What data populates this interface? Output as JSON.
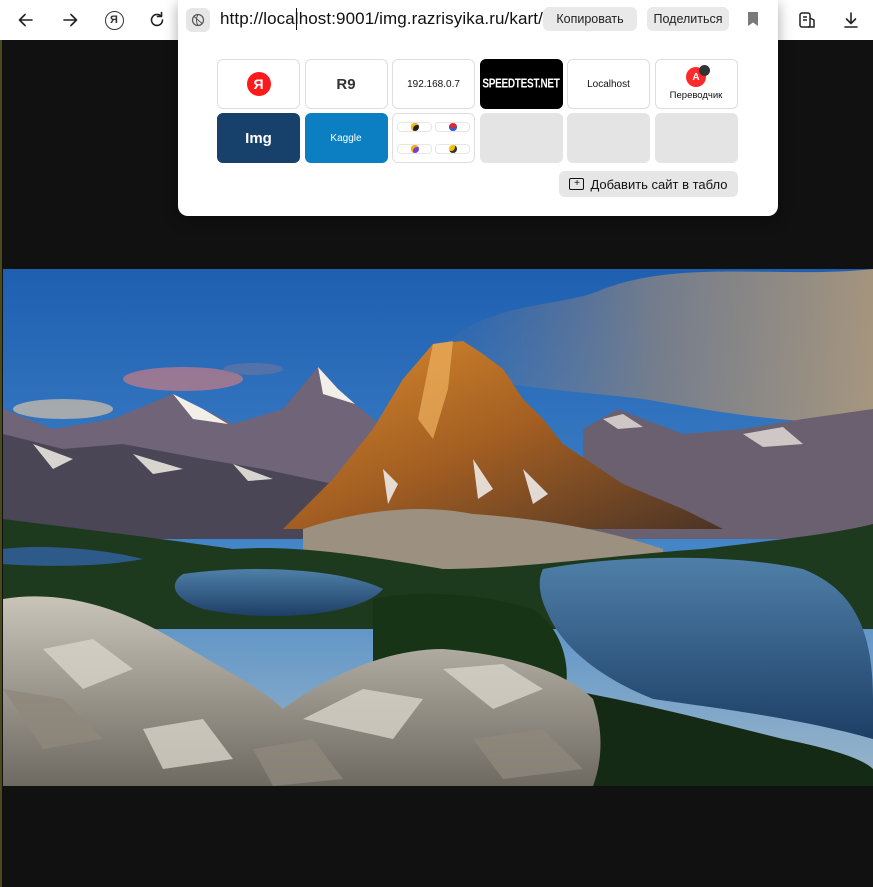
{
  "toolbar": {
    "back": "back-icon",
    "forward": "forward-icon",
    "yandex": "Я",
    "reload": "reload-icon",
    "downloads": "download-icon"
  },
  "address_bar": {
    "url": "http://localhost:9001/img.razrisyika.ru/kart/",
    "copy_label": "Копировать",
    "share_label": "Поделиться"
  },
  "tiles": {
    "yandex_letter": "Я",
    "r9": "R9",
    "ip": "192.168.0.7",
    "speedtest": "SPEEDTEST.NET",
    "localhost": "Localhost",
    "translator_logo": "A",
    "translator": "Переводчик",
    "img": "Img",
    "kaggle": "Kaggle"
  },
  "add_site_label": "Добавить сайт в табло",
  "colors": {
    "yandex_red": "#fc1a1a",
    "img_tile": "#17416b",
    "kaggle_tile": "#0b7fc1",
    "page_background": "#111111"
  }
}
